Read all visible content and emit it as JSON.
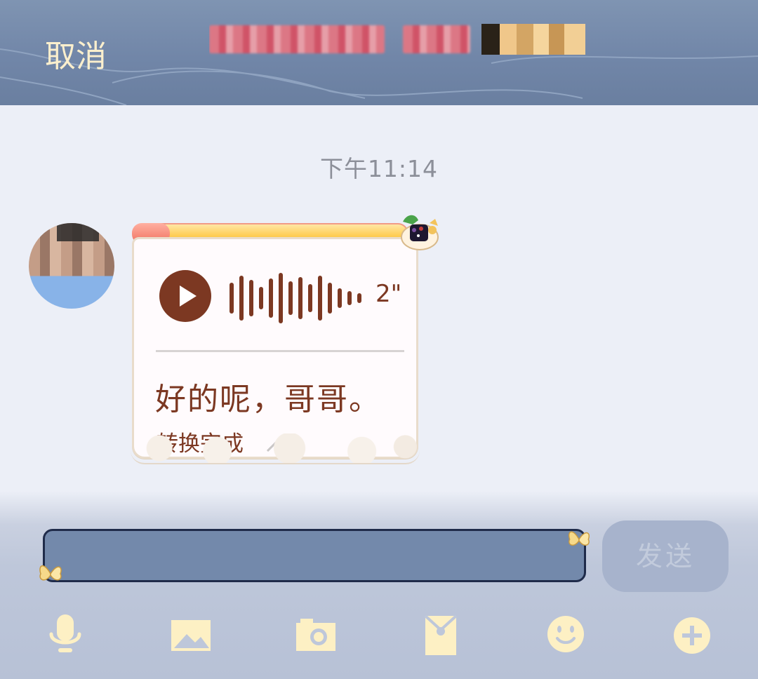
{
  "header": {
    "cancel_label": "取消",
    "title": "",
    "badge": ""
  },
  "chat": {
    "timestamp": "下午11:14",
    "message": {
      "type": "voice",
      "duration": "2\"",
      "transcript": "好的呢，哥哥。",
      "conversion_status": "转换完成"
    }
  },
  "composer": {
    "input_value": "",
    "send_label": "发送"
  },
  "toolbar": {
    "icons": [
      "microphone-icon",
      "image-icon",
      "camera-icon",
      "red-packet-icon",
      "emoji-icon",
      "plus-icon"
    ]
  },
  "colors": {
    "header_bg": "#7186a8",
    "accent_cream": "#fbefcd",
    "bubble_text": "#7c3822",
    "background": "#eceff7"
  }
}
